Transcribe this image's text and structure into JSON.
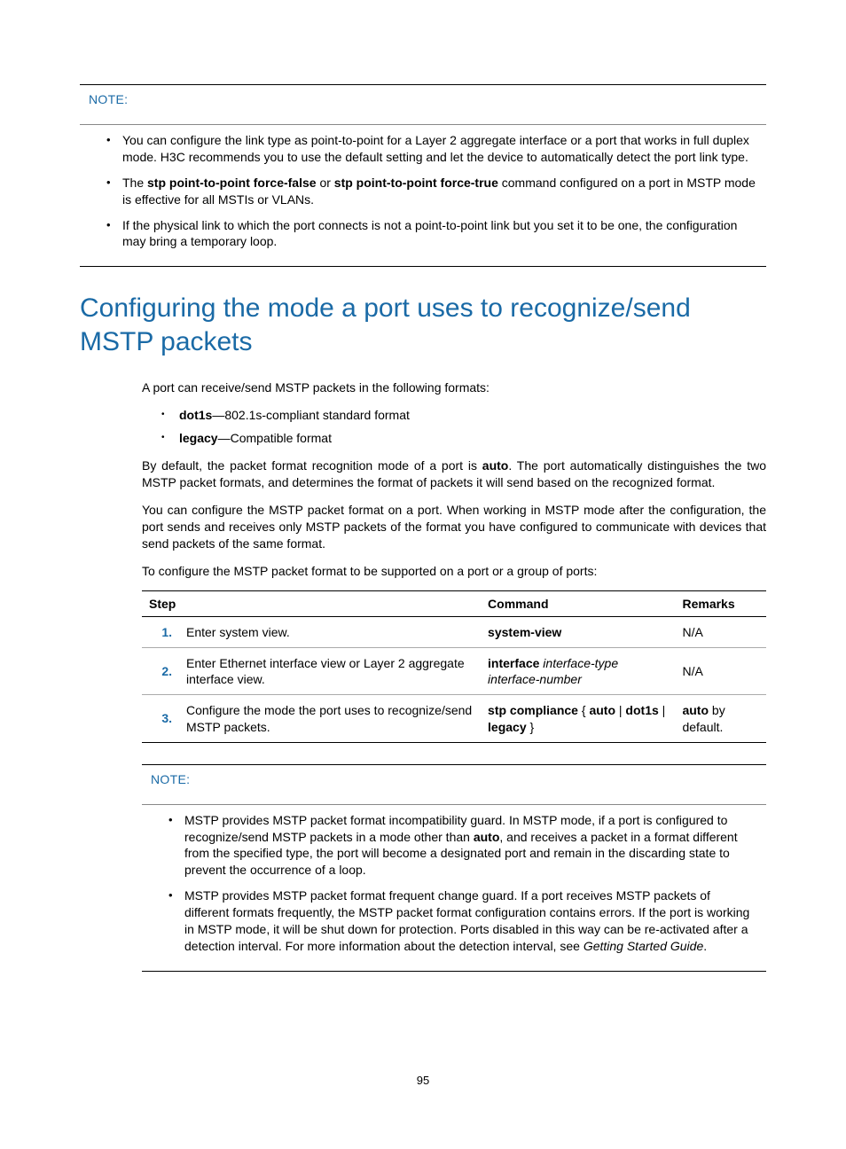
{
  "note1": {
    "label": "NOTE:",
    "items": [
      {
        "pre": "You can configure the link type as point-to-point for a Layer 2 aggregate interface or a port that works in full duplex mode. H3C recommends you to use the default setting and let the device to automatically detect the port link type."
      },
      {
        "pre": "The ",
        "b1": "stp point-to-point force-false",
        "mid": " or ",
        "b2": "stp point-to-point force-true",
        "post": " command configured on a port in MSTP mode is effective for all MSTIs or VLANs."
      },
      {
        "pre": "If the physical link to which the port connects is not a point-to-point link but you set it to be one, the configuration may bring a temporary loop."
      }
    ]
  },
  "heading": "Configuring the mode a port uses to recognize/send MSTP packets",
  "intro": "A port can receive/send MSTP packets in the following formats:",
  "formats": [
    {
      "b": "dot1s",
      "rest": "—802.1s-compliant standard format"
    },
    {
      "b": "legacy",
      "rest": "—Compatible format"
    }
  ],
  "para_default_pre": "By default, the packet format recognition mode of a port is ",
  "para_default_b": "auto",
  "para_default_post": ". The port automatically distinguishes the two MSTP packet formats, and determines the format of packets it will send based on the recognized format.",
  "para_config": "You can configure the MSTP packet format on a port. When working in MSTP mode after the configuration, the port sends and receives only MSTP packets of the format you have configured to communicate with devices that send packets of the same format.",
  "para_lead": "To configure the MSTP packet format to be supported on a port or a group of ports:",
  "table": {
    "headers": {
      "step": "Step",
      "command": "Command",
      "remarks": "Remarks"
    },
    "rows": [
      {
        "n": "1.",
        "step": "Enter system view.",
        "cmd_b": "system-view",
        "rem": "N/A"
      },
      {
        "n": "2.",
        "step": "Enter Ethernet interface view or Layer 2 aggregate interface view.",
        "cmd_b": "interface",
        "cmd_i": " interface-type interface-number",
        "rem": "N/A"
      },
      {
        "n": "3.",
        "step": "Configure the mode the port uses to recognize/send MSTP packets.",
        "cmd_b1": "stp compliance",
        "cmd_mid": " { ",
        "cmd_b2": "auto",
        "cmd_sep1": " | ",
        "cmd_b3": "dot1s",
        "cmd_sep2": " | ",
        "cmd_b4": "legacy",
        "cmd_end": " }",
        "rem_b": "auto",
        "rem_post": " by default."
      }
    ]
  },
  "note2": {
    "label": "NOTE:",
    "items": [
      {
        "pre": "MSTP provides MSTP packet format incompatibility guard. In MSTP mode, if a port is configured to recognize/send MSTP packets in a mode other than ",
        "b": "auto",
        "post": ", and receives a packet in a format different from the specified type, the port will become a designated port and remain in the discarding state to prevent the occurrence of a loop."
      },
      {
        "pre": "MSTP provides MSTP packet format frequent change guard. If a port receives MSTP packets of different formats frequently, the MSTP packet format configuration contains errors. If the port is working in MSTP mode, it will be shut down for protection. Ports disabled in this way can be re-activated after a detection interval. For more information about the detection interval, see ",
        "i": "Getting Started Guide",
        "post2": "."
      }
    ]
  },
  "pagenum": "95"
}
